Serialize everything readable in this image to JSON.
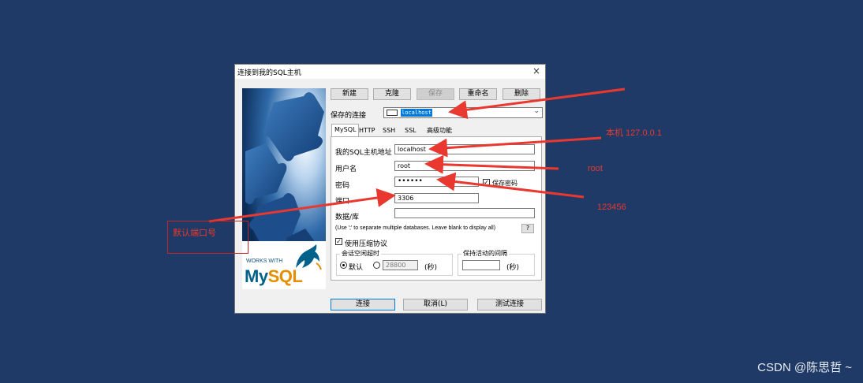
{
  "dialog": {
    "title": "连接到我的SQL主机",
    "close": "×",
    "toolbar": [
      "新建",
      "克隆",
      "保存",
      "重命名",
      "删除"
    ],
    "saved_connections_label": "保存的连接",
    "saved_connection_value": "localhost",
    "tabs": [
      "MySQL",
      "HTTP",
      "SSH",
      "SSL",
      "高级功能"
    ],
    "fields": {
      "host_label": "我的SQL主机地址",
      "host_value": "localhost",
      "user_label": "用户名",
      "user_value": "root",
      "password_label": "密码",
      "password_value": "••••••",
      "save_password_label": "保存密码",
      "port_label": "端口",
      "port_value": "3306",
      "database_label": "数据/库",
      "database_value": "",
      "hint": "(Use ';' to separate multiple databases. Leave blank to display all)",
      "help": "?"
    },
    "compression_label": "使用压缩协议",
    "session_timeout": {
      "title": "会话空闲超时",
      "default_label": "默认",
      "value": "28800",
      "unit": "(秒)"
    },
    "keepalive": {
      "title": "保持活动的间隔",
      "value": "",
      "unit": "(秒)"
    },
    "footer": [
      "连接",
      "取消(L)",
      "测试连接"
    ],
    "logo": {
      "works_with": "WORKS WITH",
      "brand_my": "My",
      "brand_sql": "SQL"
    }
  },
  "annotations": {
    "host": "本机 127.0.0.1",
    "user": "root",
    "password": "123456",
    "port": "默认端口号"
  },
  "watermark": "CSDN @陈思哲 ~",
  "colors": {
    "background": "#1f3a66",
    "annotation": "#e8382f",
    "selection": "#0078d7",
    "mysql_blue": "#00618a",
    "mysql_orange": "#e48e00"
  }
}
